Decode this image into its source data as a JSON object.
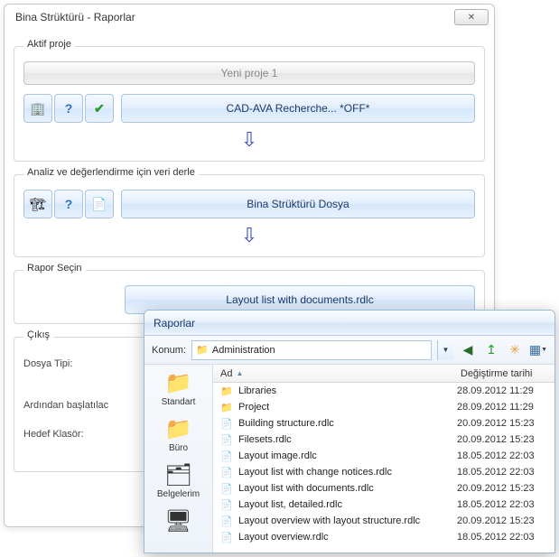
{
  "window": {
    "title": "Bina Strüktürü - Raporlar",
    "close_glyph": "✕"
  },
  "group_active": {
    "label": "Aktif proje",
    "project_button": "Yeni proje 1",
    "tool_struct": "🏢",
    "tool_help": "?",
    "tool_check": "✔",
    "cad_button": "CAD-AVA Recherche... *OFF*"
  },
  "group_compile": {
    "label": "Analiz ve değerlendirme için veri derle",
    "tool_struct": "🏗",
    "tool_help": "?",
    "tool_folder": "📄",
    "file_button": "Bina Strüktürü  Dosya"
  },
  "group_report": {
    "label": "Rapor Seçin",
    "report_button": "Layout list with documents.rdlc"
  },
  "group_output": {
    "label": "Çıkış",
    "row_type": "Dosya Tipi:",
    "row_launch": "Ardından başlatılac",
    "row_target": "Hedef Klasör:"
  },
  "arrow": "⇩",
  "browser": {
    "title": "Raporlar",
    "location_label": "Konum:",
    "location_value": "Administration",
    "location_icon": "📁",
    "tb_back": "◀",
    "tb_up": "↥",
    "tb_new": "✳",
    "tb_view": "▦",
    "places": [
      {
        "icon": "📁",
        "label": "Standart"
      },
      {
        "icon": "📁",
        "label": "Büro"
      },
      {
        "icon": "🗂",
        "label": "Belgelerim"
      },
      {
        "icon": "🖥",
        "label": ""
      }
    ],
    "col_name": "Ad",
    "col_date": "Değiştirme tarihi",
    "rows": [
      {
        "type": "folder",
        "name": "Libraries",
        "date": "28.09.2012 11:29"
      },
      {
        "type": "folder",
        "name": "Project",
        "date": "28.09.2012 11:29"
      },
      {
        "type": "file",
        "name": "Building structure.rdlc",
        "date": "20.09.2012 15:23"
      },
      {
        "type": "file",
        "name": "Filesets.rdlc",
        "date": "20.09.2012 15:23"
      },
      {
        "type": "file",
        "name": "Layout image.rdlc",
        "date": "18.05.2012 22:03"
      },
      {
        "type": "file",
        "name": "Layout list with change notices.rdlc",
        "date": "18.05.2012 22:03"
      },
      {
        "type": "file",
        "name": "Layout list with documents.rdlc",
        "date": "20.09.2012 15:23"
      },
      {
        "type": "file",
        "name": "Layout list, detailed.rdlc",
        "date": "18.05.2012 22:03"
      },
      {
        "type": "file",
        "name": "Layout overview with layout structure.rdlc",
        "date": "20.09.2012 15:23"
      },
      {
        "type": "file",
        "name": "Layout overview.rdlc",
        "date": "18.05.2012 22:03"
      }
    ]
  }
}
